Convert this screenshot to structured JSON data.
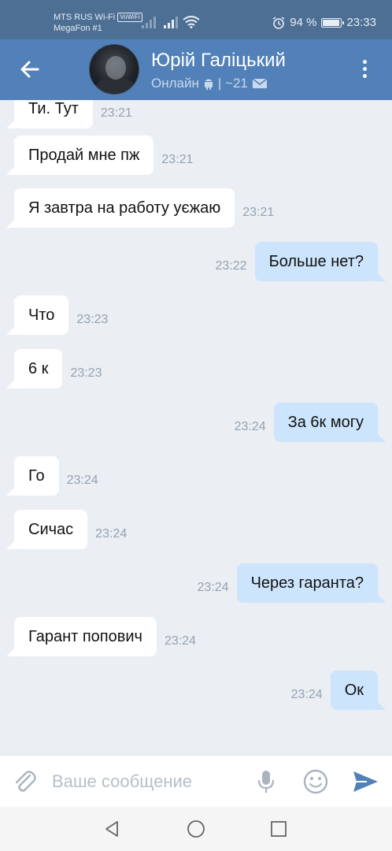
{
  "status": {
    "carrier1": "MTS RUS Wi-Fi",
    "volte": "VoWiFi",
    "carrier2": "MegaFon #1",
    "battery": "94 %",
    "battery_level": 0.94,
    "time": "23:33"
  },
  "header": {
    "name": "Юрій Галіцький",
    "presence": "Онлайн",
    "age": "| ~21"
  },
  "messages": [
    {
      "dir": "in",
      "text": "Ти. Тут",
      "time": "23:21"
    },
    {
      "dir": "in",
      "text": "Продай мне пж",
      "time": "23:21"
    },
    {
      "dir": "in",
      "text": "Я завтра на работу уєжаю",
      "time": "23:21"
    },
    {
      "dir": "out",
      "text": "Больше нет?",
      "time": "23:22"
    },
    {
      "dir": "in",
      "text": "Что",
      "time": "23:23"
    },
    {
      "dir": "in",
      "text": "6 к",
      "time": "23:23"
    },
    {
      "dir": "out",
      "text": "За 6к могу",
      "time": "23:24"
    },
    {
      "dir": "in",
      "text": "Го",
      "time": "23:24"
    },
    {
      "dir": "in",
      "text": "Сичас",
      "time": "23:24"
    },
    {
      "dir": "out",
      "text": "Через гаранта?",
      "time": "23:24"
    },
    {
      "dir": "in",
      "text": "Гарант попович",
      "time": "23:24"
    },
    {
      "dir": "out",
      "text": "Ок",
      "time": "23:24"
    }
  ],
  "input": {
    "placeholder": "Ваше сообщение"
  },
  "colors": {
    "header": "#5181b8",
    "statusbar": "#4d6f94",
    "background": "#ebeef2",
    "incoming": "#ffffff",
    "outgoing": "#cce4fc",
    "accent": "#5181b8"
  },
  "icons": [
    "back-arrow-icon",
    "android-icon",
    "mail-icon",
    "more-vertical-icon",
    "attach-icon",
    "microphone-icon",
    "emoji-icon",
    "send-icon",
    "nav-back-icon",
    "nav-home-icon",
    "nav-recent-icon",
    "alarm-icon",
    "wifi-icon",
    "signal-icon",
    "battery-icon"
  ]
}
